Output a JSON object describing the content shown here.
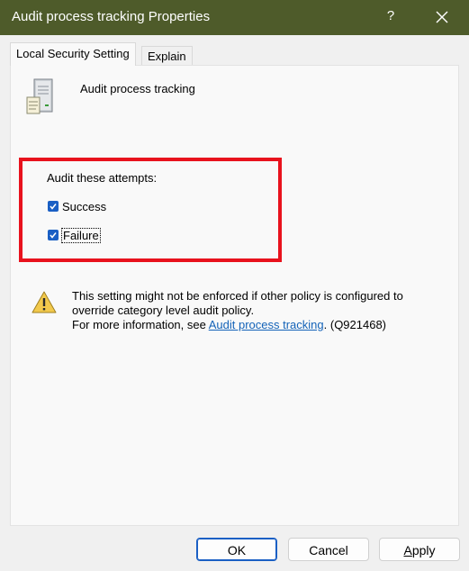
{
  "window": {
    "title": "Audit process tracking Properties",
    "help_glyph": "?",
    "title_bar_color": "#4e5b2a"
  },
  "tabs": [
    {
      "label": "Local Security Setting",
      "active": true
    },
    {
      "label": "Explain",
      "active": false
    }
  ],
  "policy": {
    "icon": "server-policy-icon",
    "name": "Audit process tracking"
  },
  "audit": {
    "group_label": "Audit these attempts:",
    "success": {
      "label": "Success",
      "checked": true
    },
    "failure": {
      "label": "Failure",
      "checked": true
    },
    "highlight_color": "#e8121d"
  },
  "warning": {
    "icon": "warning-icon",
    "line1": "This setting might not be enforced if other policy is configured to",
    "line2": "override category level audit policy.",
    "line3_prefix": "For more information, see ",
    "link_text": "Audit process tracking",
    "line3_suffix": ". (Q921468)"
  },
  "buttons": {
    "ok": "OK",
    "cancel": "Cancel",
    "apply_prefix": "A",
    "apply_rest": "pply"
  },
  "colors": {
    "checkbox": "#1a5fc4",
    "link": "#1463b8"
  }
}
